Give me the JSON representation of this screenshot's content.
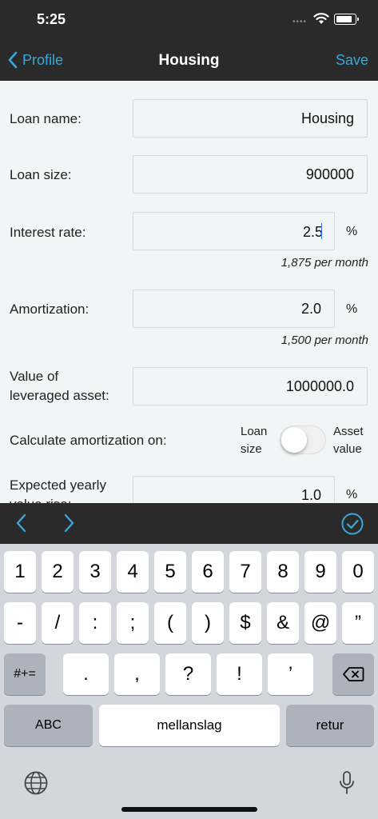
{
  "status": {
    "time": "5:25"
  },
  "nav": {
    "back_label": "Profile",
    "title": "Housing",
    "save_label": "Save"
  },
  "form": {
    "loan_name": {
      "label": "Loan name:",
      "value": "Housing"
    },
    "loan_size": {
      "label": "Loan size:",
      "value": "900000"
    },
    "interest_rate": {
      "label": "Interest rate:",
      "value": "2.5",
      "unit": "%",
      "hint": "1,875 per month"
    },
    "amortization": {
      "label": "Amortization:",
      "value": "2.0",
      "unit": "%",
      "hint": "1,500 per month"
    },
    "asset_value": {
      "label_line1": "Value of",
      "label_line2": "leveraged asset:",
      "value": "1000000.0"
    },
    "calc_amortization": {
      "label": "Calculate amortization on:",
      "left_line1": "Loan",
      "left_line2": "size",
      "right_line1": "Asset",
      "right_line2": "value",
      "toggle_on": false
    },
    "expected_yearly": {
      "label_line1": "Expected yearly",
      "label_line2": "value rise:",
      "value": "1.0",
      "unit": "%"
    }
  },
  "keyboard": {
    "row1": [
      "1",
      "2",
      "3",
      "4",
      "5",
      "6",
      "7",
      "8",
      "9",
      "0"
    ],
    "row2": [
      "-",
      "/",
      ":",
      ";",
      "(",
      ")",
      "$",
      "&",
      "@",
      "”"
    ],
    "row3": [
      ".",
      ",",
      "?",
      "!",
      "’"
    ],
    "symbols_key": "#+=",
    "abc_key": "ABC",
    "space_key": "mellanslag",
    "return_key": "retur"
  },
  "colors": {
    "accent": "#3aa7d9",
    "bar": "#2a2a2a",
    "content_bg": "#f2f5f5"
  }
}
